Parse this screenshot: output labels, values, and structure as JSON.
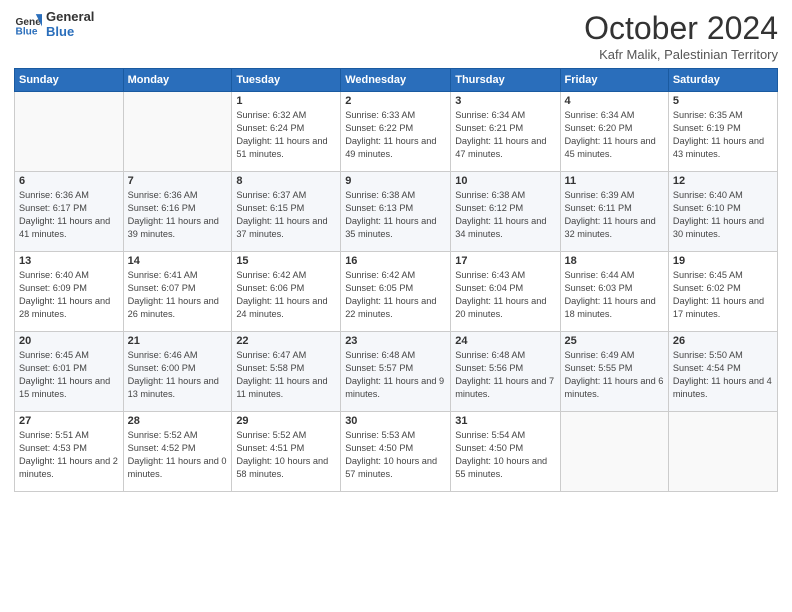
{
  "header": {
    "logo_general": "General",
    "logo_blue": "Blue",
    "month": "October 2024",
    "location": "Kafr Malik, Palestinian Territory"
  },
  "days_of_week": [
    "Sunday",
    "Monday",
    "Tuesday",
    "Wednesday",
    "Thursday",
    "Friday",
    "Saturday"
  ],
  "weeks": [
    [
      {
        "day": "",
        "info": ""
      },
      {
        "day": "",
        "info": ""
      },
      {
        "day": "1",
        "info": "Sunrise: 6:32 AM\nSunset: 6:24 PM\nDaylight: 11 hours and 51 minutes."
      },
      {
        "day": "2",
        "info": "Sunrise: 6:33 AM\nSunset: 6:22 PM\nDaylight: 11 hours and 49 minutes."
      },
      {
        "day": "3",
        "info": "Sunrise: 6:34 AM\nSunset: 6:21 PM\nDaylight: 11 hours and 47 minutes."
      },
      {
        "day": "4",
        "info": "Sunrise: 6:34 AM\nSunset: 6:20 PM\nDaylight: 11 hours and 45 minutes."
      },
      {
        "day": "5",
        "info": "Sunrise: 6:35 AM\nSunset: 6:19 PM\nDaylight: 11 hours and 43 minutes."
      }
    ],
    [
      {
        "day": "6",
        "info": "Sunrise: 6:36 AM\nSunset: 6:17 PM\nDaylight: 11 hours and 41 minutes."
      },
      {
        "day": "7",
        "info": "Sunrise: 6:36 AM\nSunset: 6:16 PM\nDaylight: 11 hours and 39 minutes."
      },
      {
        "day": "8",
        "info": "Sunrise: 6:37 AM\nSunset: 6:15 PM\nDaylight: 11 hours and 37 minutes."
      },
      {
        "day": "9",
        "info": "Sunrise: 6:38 AM\nSunset: 6:13 PM\nDaylight: 11 hours and 35 minutes."
      },
      {
        "day": "10",
        "info": "Sunrise: 6:38 AM\nSunset: 6:12 PM\nDaylight: 11 hours and 34 minutes."
      },
      {
        "day": "11",
        "info": "Sunrise: 6:39 AM\nSunset: 6:11 PM\nDaylight: 11 hours and 32 minutes."
      },
      {
        "day": "12",
        "info": "Sunrise: 6:40 AM\nSunset: 6:10 PM\nDaylight: 11 hours and 30 minutes."
      }
    ],
    [
      {
        "day": "13",
        "info": "Sunrise: 6:40 AM\nSunset: 6:09 PM\nDaylight: 11 hours and 28 minutes."
      },
      {
        "day": "14",
        "info": "Sunrise: 6:41 AM\nSunset: 6:07 PM\nDaylight: 11 hours and 26 minutes."
      },
      {
        "day": "15",
        "info": "Sunrise: 6:42 AM\nSunset: 6:06 PM\nDaylight: 11 hours and 24 minutes."
      },
      {
        "day": "16",
        "info": "Sunrise: 6:42 AM\nSunset: 6:05 PM\nDaylight: 11 hours and 22 minutes."
      },
      {
        "day": "17",
        "info": "Sunrise: 6:43 AM\nSunset: 6:04 PM\nDaylight: 11 hours and 20 minutes."
      },
      {
        "day": "18",
        "info": "Sunrise: 6:44 AM\nSunset: 6:03 PM\nDaylight: 11 hours and 18 minutes."
      },
      {
        "day": "19",
        "info": "Sunrise: 6:45 AM\nSunset: 6:02 PM\nDaylight: 11 hours and 17 minutes."
      }
    ],
    [
      {
        "day": "20",
        "info": "Sunrise: 6:45 AM\nSunset: 6:01 PM\nDaylight: 11 hours and 15 minutes."
      },
      {
        "day": "21",
        "info": "Sunrise: 6:46 AM\nSunset: 6:00 PM\nDaylight: 11 hours and 13 minutes."
      },
      {
        "day": "22",
        "info": "Sunrise: 6:47 AM\nSunset: 5:58 PM\nDaylight: 11 hours and 11 minutes."
      },
      {
        "day": "23",
        "info": "Sunrise: 6:48 AM\nSunset: 5:57 PM\nDaylight: 11 hours and 9 minutes."
      },
      {
        "day": "24",
        "info": "Sunrise: 6:48 AM\nSunset: 5:56 PM\nDaylight: 11 hours and 7 minutes."
      },
      {
        "day": "25",
        "info": "Sunrise: 6:49 AM\nSunset: 5:55 PM\nDaylight: 11 hours and 6 minutes."
      },
      {
        "day": "26",
        "info": "Sunrise: 5:50 AM\nSunset: 4:54 PM\nDaylight: 11 hours and 4 minutes."
      }
    ],
    [
      {
        "day": "27",
        "info": "Sunrise: 5:51 AM\nSunset: 4:53 PM\nDaylight: 11 hours and 2 minutes."
      },
      {
        "day": "28",
        "info": "Sunrise: 5:52 AM\nSunset: 4:52 PM\nDaylight: 11 hours and 0 minutes."
      },
      {
        "day": "29",
        "info": "Sunrise: 5:52 AM\nSunset: 4:51 PM\nDaylight: 10 hours and 58 minutes."
      },
      {
        "day": "30",
        "info": "Sunrise: 5:53 AM\nSunset: 4:50 PM\nDaylight: 10 hours and 57 minutes."
      },
      {
        "day": "31",
        "info": "Sunrise: 5:54 AM\nSunset: 4:50 PM\nDaylight: 10 hours and 55 minutes."
      },
      {
        "day": "",
        "info": ""
      },
      {
        "day": "",
        "info": ""
      }
    ]
  ]
}
